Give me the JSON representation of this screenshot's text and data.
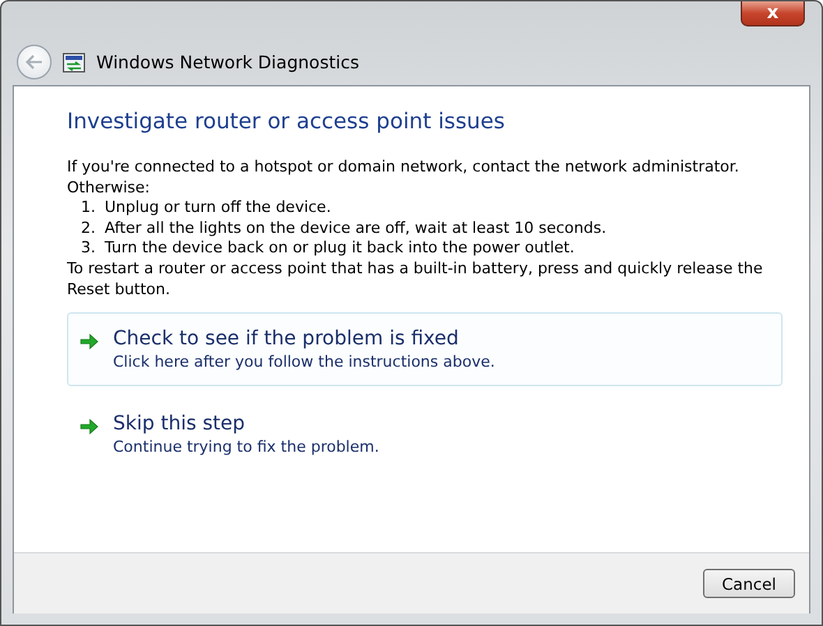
{
  "window": {
    "title": "Windows Network Diagnostics",
    "close": "x"
  },
  "heading": "Investigate router or access point issues",
  "intro": [
    "If you're connected to a hotspot or domain network, contact the network administrator.",
    "Otherwise:"
  ],
  "steps": [
    {
      "number": "1.",
      "text": "Unplug or turn off the device."
    },
    {
      "number": "2.",
      "text": "After all the lights on the device are off, wait at least 10 seconds."
    },
    {
      "number": "3.",
      "text": "Turn the device back on or plug it back into the power outlet."
    }
  ],
  "note": "To restart a router or access point that has a built-in battery, press and quickly release the Reset button.",
  "options": [
    {
      "title": "Check to see if the problem is fixed",
      "description": "Click here after you follow the instructions above.",
      "selected": true
    },
    {
      "title": "Skip this step",
      "description": "Continue trying to fix the problem.",
      "selected": false
    }
  ],
  "buttons": [
    "Cancel"
  ]
}
